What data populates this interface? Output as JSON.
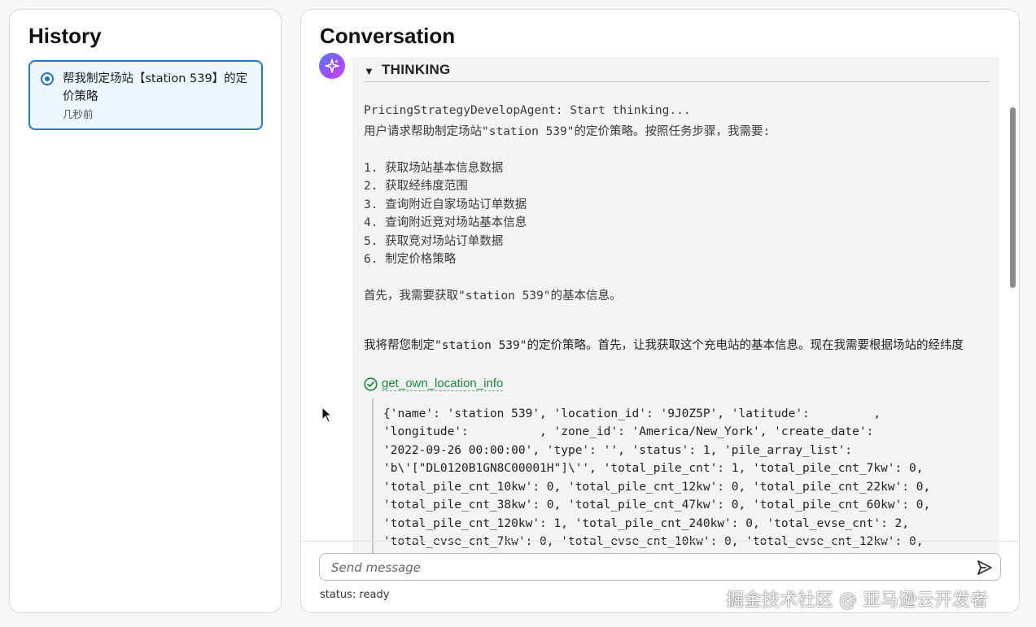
{
  "history": {
    "title": "History",
    "items": [
      {
        "title": "帮我制定场站【station 539】的定价策略",
        "time": "几秒前",
        "selected": true
      }
    ]
  },
  "conversation": {
    "title": "Conversation",
    "thinking": {
      "label": "THINKING",
      "lines": [
        "PricingStrategyDevelopAgent: Start thinking...",
        "用户请求帮助制定场站\"station 539\"的定价策略。按照任务步骤，我需要:",
        "",
        "1. 获取场站基本信息数据",
        "2. 获取经纬度范围",
        "3. 查询附近自家场站订单数据",
        "4. 查询附近竞对场站基本信息",
        "5. 获取竞对场站订单数据",
        "6. 制定价格策略",
        "",
        "首先，我需要获取\"station 539\"的基本信息。"
      ]
    },
    "reply_text": "我将帮您制定\"station 539\"的定价策略。首先，让我获取这个充电站的基本信息。现在我需要根据场站的经纬度",
    "tool_call": {
      "name": "get_own_location_info",
      "status_icon": "check-circle-icon",
      "result_lines": [
        "{'name': 'station 539', 'location_id': '9J0Z5P', 'latitude':         ,",
        "'longitude':          , 'zone_id': 'America/New_York', 'create_date':",
        "'2022-09-26 00:00:00', 'type': '', 'status': 1, 'pile_array_list':",
        "'b\\'[\"DL0120B1GN8C00001H\"]\\'', 'total_pile_cnt': 1, 'total_pile_cnt_7kw': 0,",
        "'total_pile_cnt_10kw': 0, 'total_pile_cnt_12kw': 0, 'total_pile_cnt_22kw': 0,",
        "'total_pile_cnt_38kw': 0, 'total_pile_cnt_47kw': 0, 'total_pile_cnt_60kw': 0,",
        "'total_pile_cnt_120kw': 1, 'total_pile_cnt_240kw': 0, 'total_evse_cnt': 2,",
        "'total_evse_cnt_7kw': 0, 'total_evse_cnt_10kw': 0, 'total_evse_cnt_12kw': 0,"
      ]
    },
    "input": {
      "placeholder": "Send message",
      "value": ""
    },
    "status": "status: ready"
  },
  "watermark": "掘金技术社区 @ 亚马逊云开发者",
  "colors": {
    "accent": "#1a7ad4",
    "tool_success": "#1a8a3a",
    "panel_bg": "#ffffff",
    "thinking_bg": "#f3f3f3"
  }
}
